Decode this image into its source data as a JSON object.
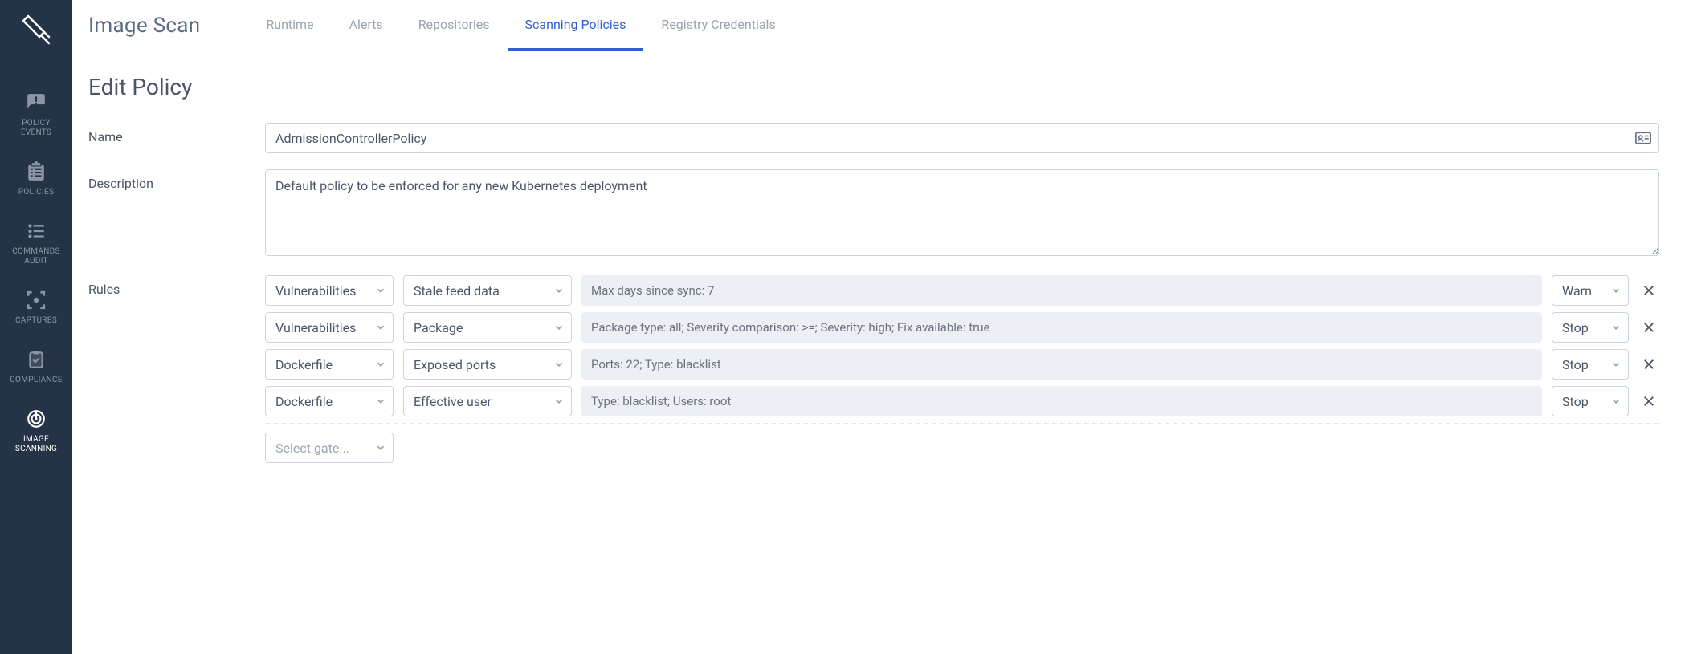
{
  "sidebar": {
    "items": [
      {
        "label": "POLICY\nEVENTS"
      },
      {
        "label": "POLICIES"
      },
      {
        "label": "COMMANDS\nAUDIT"
      },
      {
        "label": "CAPTURES"
      },
      {
        "label": "COMPLIANCE"
      },
      {
        "label": "IMAGE\nSCANNING"
      }
    ]
  },
  "header": {
    "title": "Image Scan",
    "tabs": [
      {
        "label": "Runtime"
      },
      {
        "label": "Alerts"
      },
      {
        "label": "Repositories"
      },
      {
        "label": "Scanning Policies",
        "active": true
      },
      {
        "label": "Registry Credentials"
      }
    ]
  },
  "page": {
    "heading": "Edit Policy",
    "name_label": "Name",
    "name_value": "AdmissionControllerPolicy",
    "desc_label": "Description",
    "desc_value": "Default policy to be enforced for any new Kubernetes deployment",
    "rules_label": "Rules",
    "rules": [
      {
        "gate": "Vulnerabilities",
        "trigger": "Stale feed data",
        "params": "Max days since sync: 7",
        "action": "Warn"
      },
      {
        "gate": "Vulnerabilities",
        "trigger": "Package",
        "params": "Package type: all; Severity comparison: >=; Severity: high; Fix available: true",
        "action": "Stop"
      },
      {
        "gate": "Dockerfile",
        "trigger": "Exposed ports",
        "params": "Ports: 22; Type: blacklist",
        "action": "Stop"
      },
      {
        "gate": "Dockerfile",
        "trigger": "Effective user",
        "params": "Type: blacklist; Users: root",
        "action": "Stop"
      }
    ],
    "add_gate_placeholder": "Select gate..."
  }
}
